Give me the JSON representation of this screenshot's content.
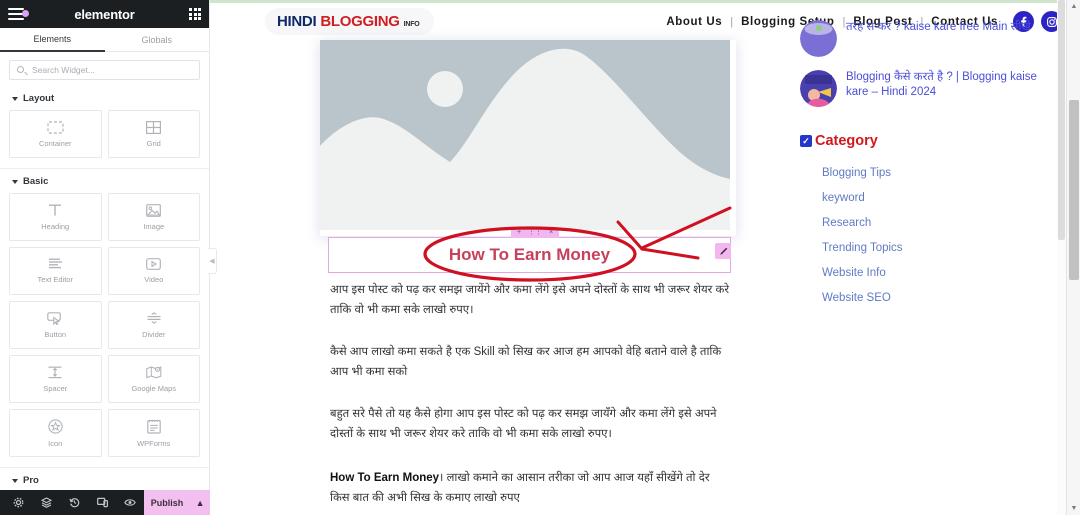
{
  "panel": {
    "brand": "elementor",
    "menu_icon": "hamburger-icon",
    "apps_icon": "apps-grid-icon",
    "tabs": [
      {
        "label": "Elements",
        "active": true
      },
      {
        "label": "Globals",
        "active": false
      }
    ],
    "search": {
      "placeholder": "Search Widget...",
      "value": ""
    },
    "sections": [
      {
        "title": "Layout",
        "widgets": [
          {
            "label": "Container",
            "icon": "container-icon"
          },
          {
            "label": "Grid",
            "icon": "grid-icon"
          }
        ]
      },
      {
        "title": "Basic",
        "widgets": [
          {
            "label": "Heading",
            "icon": "heading-icon"
          },
          {
            "label": "Image",
            "icon": "image-icon"
          },
          {
            "label": "Text Editor",
            "icon": "text-editor-icon"
          },
          {
            "label": "Video",
            "icon": "video-icon"
          },
          {
            "label": "Button",
            "icon": "button-icon"
          },
          {
            "label": "Divider",
            "icon": "divider-icon"
          },
          {
            "label": "Spacer",
            "icon": "spacer-icon"
          },
          {
            "label": "Google Maps",
            "icon": "google-maps-icon"
          },
          {
            "label": "Icon",
            "icon": "star-icon"
          },
          {
            "label": "WPForms",
            "icon": "wpforms-icon"
          }
        ]
      },
      {
        "title": "Pro",
        "widgets": []
      }
    ],
    "footer": {
      "icons": [
        "settings-gear-icon",
        "navigator-layers-icon",
        "history-revisions-icon",
        "responsive-preview-icon",
        "preview-eye-icon"
      ],
      "publish_label": "Publish",
      "publish_caret": "chevron-up-icon",
      "publish_color": "#f3bfee"
    },
    "collapse_handle_icon": "chevron-left-icon"
  },
  "site": {
    "logo": {
      "part1": "HINDI",
      "part2": "BLOGGING",
      "part3": "INFO",
      "color1": "#0e2a6b",
      "color2": "#cf1f23"
    },
    "nav": [
      {
        "label": "About Us"
      },
      {
        "label": "Blogging Setup"
      },
      {
        "label": "Blog Post"
      },
      {
        "label": "Contact Us"
      }
    ],
    "nav_separator": "|",
    "social": [
      {
        "name": "facebook-icon",
        "color": "#2d23c4"
      },
      {
        "name": "instagram-icon",
        "color": "#2d23c4"
      }
    ]
  },
  "content": {
    "featured_image_alt": "placeholder-mountain-sun-image",
    "heading_widget": {
      "text": "How To Earn Money",
      "selected": true,
      "handle": {
        "add": "+",
        "drag": "drag-dots-icon",
        "close": "×"
      },
      "edit_icon": "pencil-edit-icon",
      "accent": "#f2b7ef"
    },
    "paragraphs": [
      "आप इस पोस्ट को पढ़ कर समझ जायेंगे और कमा लेंगे इसे अपने दोस्तों के साथ भी जरूर शेयर करे ताकि वो भी कमा सके लाखो रुपए।",
      "कैसे आप लाखो कमा सकते है एक Skill को सिख कर आज हम आपको वेहि बताने वाले है ताकि आप भी कमा सको",
      "बहुत सरे पैसे तो यह कैसे होगा आप इस पोस्ट को पढ़ कर समझ जायँगे और कमा लेंगे इसे अपने दोस्तों के साथ भी जरूर शेयर करे ताकि वो भी कमा सके लाखो रुपए।"
    ],
    "last_paragraph": {
      "bold_prefix": "How To Earn Money",
      "rest": "। लाखो कमाने का आसान तरीका जो आप आज यहाँ सीखेंगे तो देर किस बात की अभी सिख के कमाए लाखो रुपए"
    },
    "annotation": {
      "shape": "red-ellipse-and-arrow",
      "color": "#d01020"
    }
  },
  "sidebar": {
    "recent_posts": [
      {
        "title": "तरह स कर ? kaise kare free Main सीखे",
        "thumb": "post-thumbnail"
      },
      {
        "title": "Blogging कैसे करते है ? | Blogging kaise kare – Hindi 2024",
        "thumb": "post-thumbnail"
      }
    ],
    "category": {
      "heading": "Category",
      "heading_color": "#d0191f",
      "checkbox_icon": "checkbox-checked-icon",
      "items": [
        "Blogging Tips",
        "keyword",
        "Research",
        "Trending Topics",
        "Website Info",
        "Website SEO"
      ],
      "link_color": "#5f7bc4"
    }
  },
  "scrollbars": {
    "browser": {
      "up_arrow": "▲",
      "down_arrow": "▼"
    },
    "preview": {
      "visible": true
    }
  }
}
